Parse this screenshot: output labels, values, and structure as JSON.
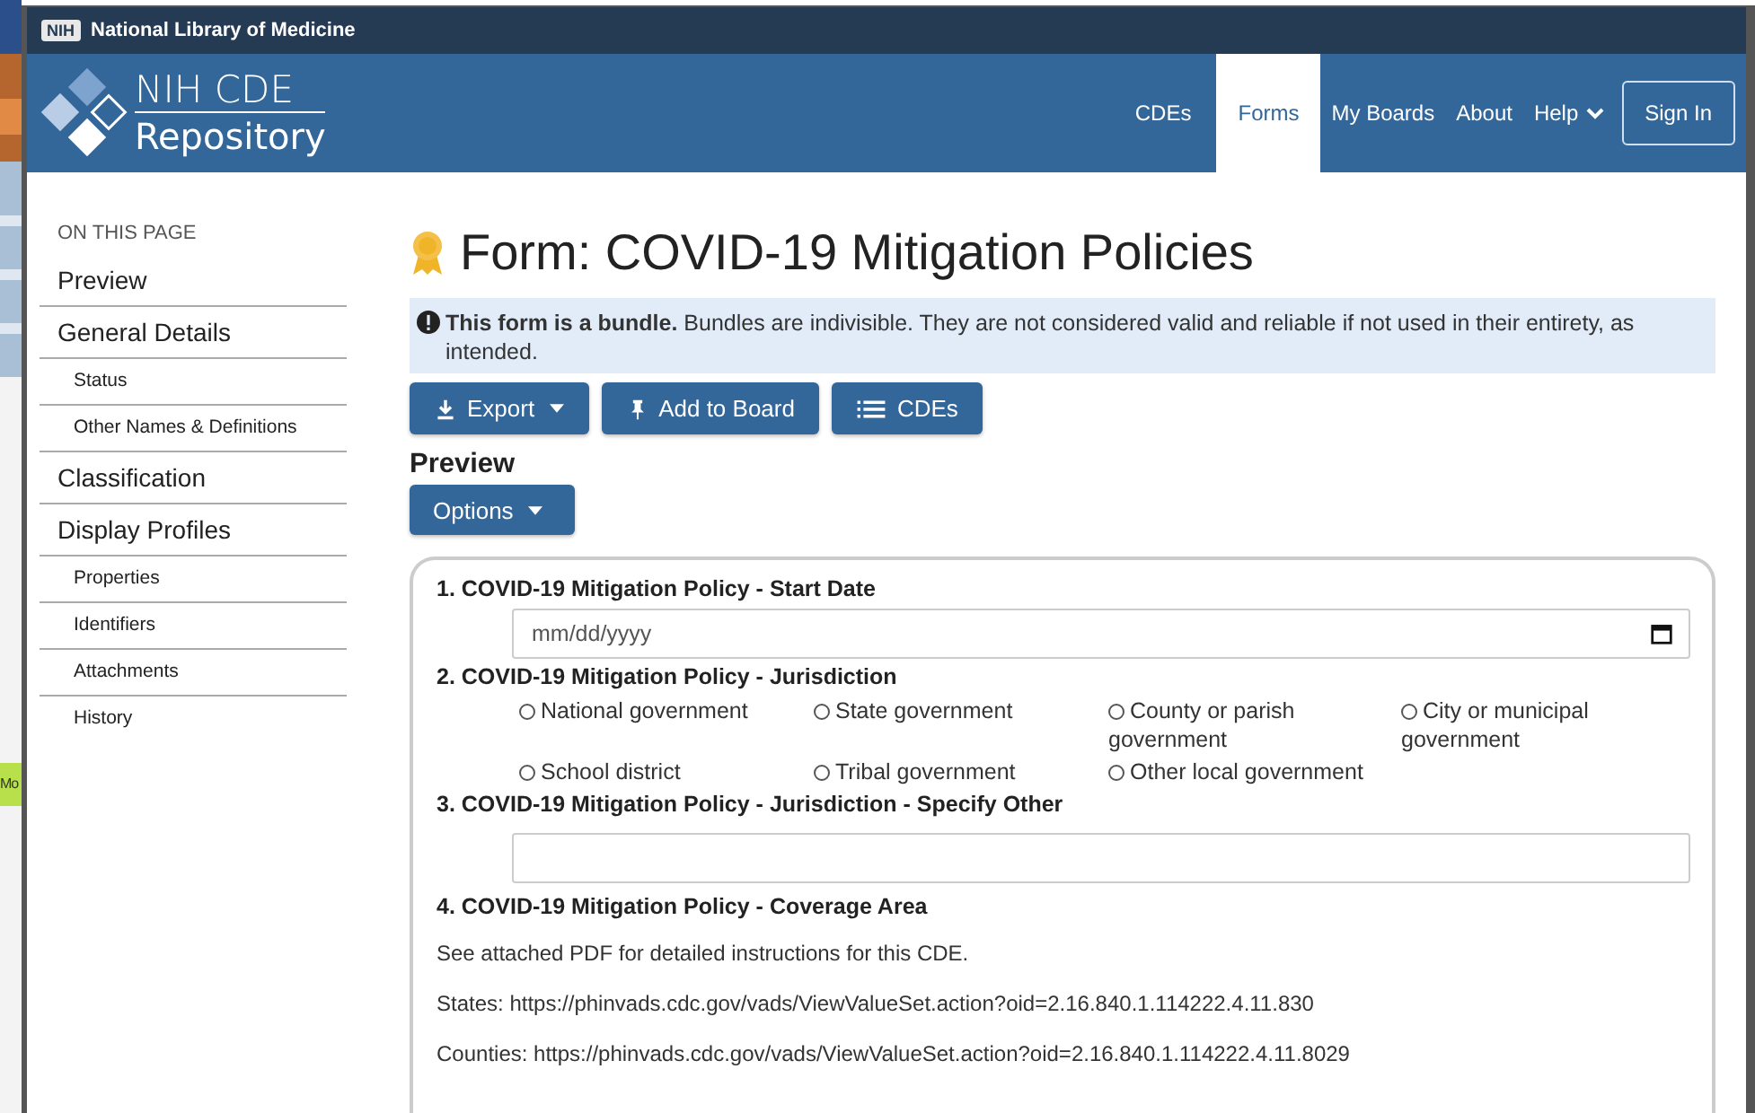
{
  "desktop": {
    "chip": "Mo"
  },
  "top_bar": {
    "badge": "NIH",
    "title": "National Library of Medicine"
  },
  "header": {
    "logo_line_1": "NIH CDE",
    "logo_line_2": "Repository",
    "nav": [
      {
        "label": "CDEs",
        "selected": false,
        "kind": "link"
      },
      {
        "label": "Forms",
        "selected": true,
        "kind": "link"
      },
      {
        "label": "My Boards",
        "selected": false,
        "kind": "link"
      },
      {
        "label": "About",
        "selected": false,
        "kind": "link"
      },
      {
        "label": "Help",
        "selected": false,
        "kind": "menu"
      },
      {
        "label": "Sign In",
        "selected": false,
        "kind": "outline"
      }
    ]
  },
  "sidebar": {
    "heading": "ON THIS PAGE",
    "items": [
      {
        "label": "Preview",
        "kind": "section"
      },
      {
        "label": "General Details",
        "kind": "section"
      },
      {
        "label": "Status",
        "kind": "sub"
      },
      {
        "label": "Other Names & Definitions",
        "kind": "sub"
      },
      {
        "label": "Classification",
        "kind": "section"
      },
      {
        "label": "Display Profiles",
        "kind": "section"
      },
      {
        "label": "Properties",
        "kind": "sub"
      },
      {
        "label": "Identifiers",
        "kind": "sub"
      },
      {
        "label": "Attachments",
        "kind": "sub"
      },
      {
        "label": "History",
        "kind": "sub"
      }
    ]
  },
  "title": "Form: COVID-19 Mitigation Policies",
  "alert": "**This form is a bundle.** Bundles are indivisible. They are not considered valid and reliable if not used in their entirety, as intended.",
  "actions": [
    {
      "label": "Export",
      "kind": "export"
    },
    {
      "label": "Add to Board",
      "kind": "pin"
    },
    {
      "label": "CDEs",
      "kind": "list"
    }
  ],
  "preview": {
    "heading": "Preview",
    "options_button": "Options"
  },
  "questions": [
    {
      "label": "1. COVID-19 Mitigation Policy - Start Date",
      "kind": "date",
      "placeholder": "mm/dd/yyyy"
    },
    {
      "label": "2. COVID-19 Mitigation Policy - Jurisdiction",
      "kind": "radio",
      "options": [
        {
          "label": "National government",
          "selected": false
        },
        {
          "label": "State government",
          "selected": false
        },
        {
          "label": "County or parish government",
          "selected": false
        },
        {
          "label": "City or municipal government",
          "selected": false
        },
        {
          "label": "School district",
          "selected": false
        },
        {
          "label": "Tribal government",
          "selected": false
        },
        {
          "label": "Other local government",
          "selected": false
        }
      ]
    },
    {
      "label": "3. COVID-19 Mitigation Policy - Jurisdiction - Specify Other",
      "kind": "text"
    },
    {
      "label": "4. COVID-19 Mitigation Policy - Coverage Area",
      "kind": "info",
      "paragraphs": [
        "See attached PDF for detailed instructions for this CDE.",
        "States: https://phinvads.cdc.gov/vads/ViewValueSet.action?oid=2.16.840.1.114222.4.11.830",
        "Counties: https://phinvads.cdc.gov/vads/ViewValueSet.action?oid=2.16.840.1.114222.4.11.8029"
      ]
    }
  ]
}
